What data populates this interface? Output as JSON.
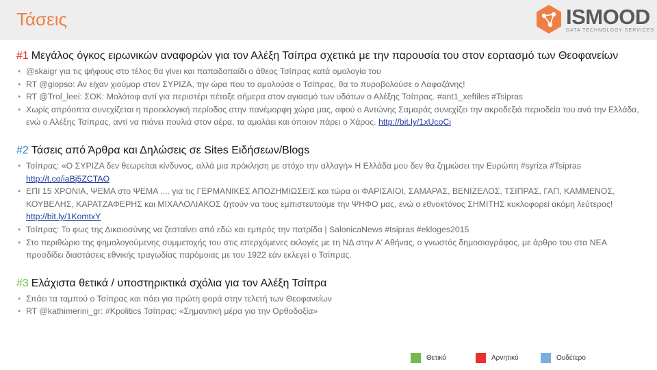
{
  "header": {
    "title": "Τάσεις",
    "logo_text": "ISMOOD",
    "logo_subtitle": "DATA TECHNOLOGY SERVICES"
  },
  "sections": [
    {
      "number": "#1",
      "heading": "Μεγάλος όγκος ειρωνικών αναφορών για τον Αλέξη Τσίπρα σχετικά με την παρουσία του στον εορτασμό των Θεοφανείων",
      "items": [
        {
          "text": "@skaigr για τις ψήφους στο τέλος θα γίνει και παπαδοπαίδι ο άθεος Τσίπρας κατά ομολογία του",
          "link": ""
        },
        {
          "text": "RT @giopso: Αν είχαν χιούμορ στον ΣΥΡΙΖΑ, την ώρα που το αμολούσε ο Τσίπρας, θα το πυροβολούσε ο Λαφαζάνης!",
          "link": ""
        },
        {
          "text": "RT @Trol_leei: ΣΟΚ: Μολότοφ αντί για περιστέρι πέταξε σήμερα στον αγιασμό των υδάτων ο Αλέξης Τσίπρας. #ant1_xeftiles #Tsipras",
          "link": ""
        },
        {
          "text": "Χωρίς απρόοπτα συνεχίζεται η προεκλογική περίοδος στην πανέμορφη χώρα μας, αφού ο Αντώνης Σαμαράς συνεχίζει την ακροδεξιά περιοδεία του ανά την Ελλάδα, ενώ ο Αλέξης Τσίπρας, αντί να πιάνει πουλιά στον αέρα, τα αμολάει και όποιον πάρει ο Χάρος.",
          "link": "http://bit.ly/1xUcoCi"
        }
      ]
    },
    {
      "number": "#2",
      "heading": "Τάσεις από Άρθρα και Δηλώσεις σε Sites Ειδήσεων/Blogs",
      "items": [
        {
          "text": "Τσίπρας: «Ο ΣΥΡΙΖΑ δεν θεωρείται κίνδυνος, αλλά μια πρόκληση με στόχο την αλλαγή» Η Ελλάδα μου δεν θα ζημιώσει την Ευρώπη #syriza #Tsipras",
          "link": "http://t.co/iaBj5ZCTAO"
        },
        {
          "text": "ΕΠΙ 15 ΧΡΟΝΙΑ, ΨΕΜΑ στο ΨΕΜΑ .... για τις ΓΕΡΜΑΝΙΚΕΣ ΑΠΟΖΗΜΙΩΣΕΙΣ και τώρα οι ΦΑΡΙΣΑΙΟΙ, ΣΑΜΑΡΑΣ, ΒΕΝΙΖΕΛΟΣ, ΤΣΙΠΡΑΣ, ΓΑΠ, ΚΑΜΜΕΝΟΣ, ΚΟΥΒΕΛΗΣ, ΚΑΡΑΤΖΑΦΕΡΗΣ και ΜΙΧΑΛΟΛΙΑΚΟΣ ζητούν να τους εμπιστευτούμε την ΨΗΦΟ μας, ενώ ο εθνοκτόνος ΣΗΜΙΤΗΣ κυκλοφορεί ακόμη λεύτερος!",
          "link": "http://bit.ly/1KomtxY"
        },
        {
          "text": "Τσίπρας: Το φως της Δικαιοσύνης να ζεσταίνει από εδώ και εμπρός την πατρίδα | SalonicaNews #tsipras #ekloges2015",
          "link": ""
        },
        {
          "text": "Στο περιθώριο της φημολογούμενης συμμετοχής του στις επερχόμενες εκλογές με τη ΝΔ στην Α' Αθήνας, ο γνωστός δημοσιογράφος, με άρθρο του στα ΝΕΑ προσδίδει διαστάσεις εθνικής τραγωδίας παρόμοιας με του 1922 εάν εκλεγεί ο Τσίπρας.",
          "link": ""
        }
      ]
    },
    {
      "number": "#3",
      "heading": "Ελάχιστα θετικά / υποστηρικτικά σχόλια για τον Αλέξη Τσίπρα",
      "items": [
        {
          "text": "Σπάει τα ταμπού ο Τσίπρας και πάει για πρώτη φορά στην τελετή των Θεοφανείων",
          "link": ""
        },
        {
          "text": "RT @kathimerini_gr: #Kpolitics Τσίπρας: «Σημαντική μέρα για την Ορθοδοξία»",
          "link": ""
        }
      ]
    }
  ],
  "legend": [
    {
      "label": "Θετικό",
      "color": "#76b74e"
    },
    {
      "label": "Αρνητικό",
      "color": "#e8322d"
    },
    {
      "label": "Ουδέτερο",
      "color": "#7aaedc"
    }
  ],
  "colors": {
    "title": "#f07f43",
    "section1_number": "#e0312c",
    "section2_number": "#2f7fc1",
    "section3_number": "#6cbd45",
    "logo_hexagon": "#f07f43"
  },
  "icons": {
    "logo": "hexagon-network-icon"
  }
}
